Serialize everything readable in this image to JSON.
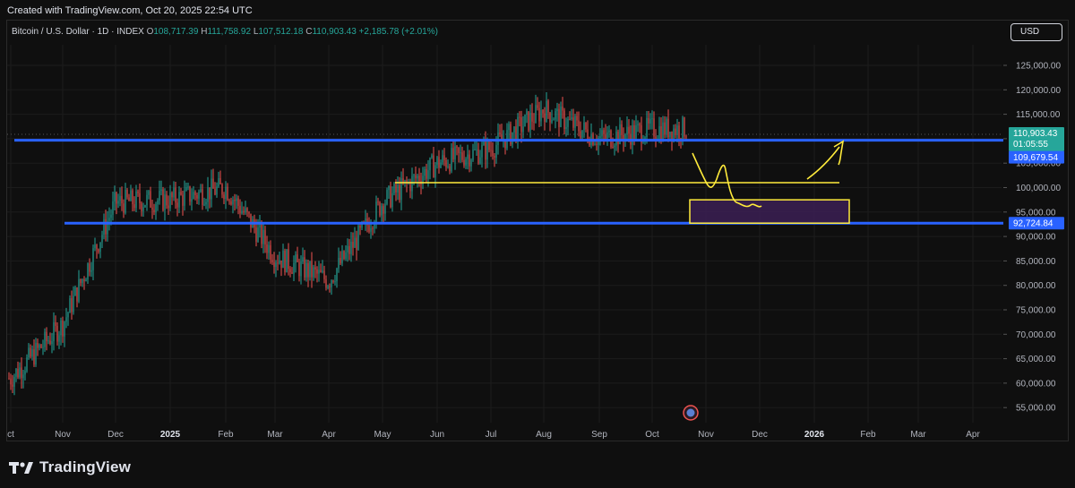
{
  "header": {
    "created_text": "Created with TradingView.com, Oct 20, 2025 22:54 UTC"
  },
  "legend": {
    "symbol": "Bitcoin / U.S. Dollar · 1D · INDEX",
    "o_label": "O",
    "o_value": "108,717.39",
    "h_label": "H",
    "h_value": "111,758.92",
    "l_label": "L",
    "l_value": "107,512.18",
    "c_label": "C",
    "c_value": "110,903.43",
    "change": "+2,185.78 (+2.01%)"
  },
  "currency_button": "USD",
  "brand": {
    "name": "TradingView"
  },
  "colors": {
    "up": "#26a69a",
    "down": "#ef5350",
    "hline": "#2962ff",
    "drawing": "#ffeb3b",
    "box_fill": "#3b1f54",
    "price_tag": "#26a69a",
    "support_tag": "#2962ff"
  },
  "chart_data": {
    "type": "line",
    "title": "",
    "xlabel": "",
    "ylabel": "",
    "ylim": [
      52000,
      128000
    ],
    "y_ticks": [
      "125,000.00",
      "120,000.00",
      "115,000.00",
      "110,000.00",
      "105,000.00",
      "100,000.00",
      "95,000.00",
      "90,000.00",
      "85,000.00",
      "80,000.00",
      "75,000.00",
      "70,000.00",
      "65,000.00",
      "60,000.00",
      "55,000.00"
    ],
    "x_ticks": [
      "ct",
      "Nov",
      "Dec",
      "2025",
      "Feb",
      "Mar",
      "Apr",
      "May",
      "Jun",
      "Jul",
      "Aug",
      "Sep",
      "Oct",
      "Nov",
      "Dec",
      "2026",
      "Feb",
      "Mar",
      "Apr"
    ],
    "x": [
      "Oct 2024",
      "Nov 2024",
      "Dec 2024",
      "Jan 2025",
      "Feb 2025",
      "Mar 2025",
      "Apr 2025",
      "May 2025",
      "Jun 2025",
      "Jul 2025",
      "Aug 2025",
      "Sep 2025",
      "Oct 2025"
    ],
    "series": [
      {
        "values": [
          64000,
          72000,
          97000,
          98000,
          100000,
          88000,
          83000,
          97000,
          105000,
          108000,
          117000,
          110000,
          112000
        ]
      }
    ],
    "price_labels": {
      "last_price": "110,903.43",
      "countdown": "01:05:55",
      "level_mid": "109,679.54",
      "level_low": "92,724.84"
    },
    "horizontal_levels": [
      109679.54,
      92724.84,
      101000
    ],
    "zone": {
      "top": 97500,
      "bottom": 92724.84
    }
  }
}
